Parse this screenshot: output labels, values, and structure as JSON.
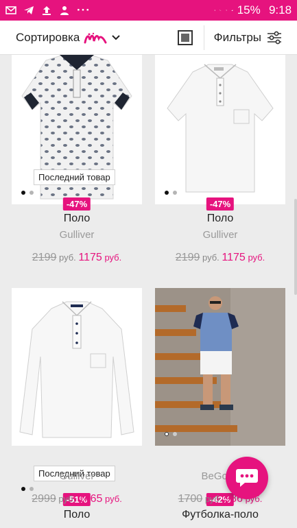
{
  "status_bar": {
    "battery": "15%",
    "time": "9:18",
    "more": "···",
    "icons": [
      "envelope-icon",
      "telegram-icon",
      "upload-icon",
      "person-icon",
      "bluetooth-icon",
      "call-icon",
      "wifi-icon",
      "signal-icon",
      "battery-icon"
    ]
  },
  "toolbar": {
    "sort_label": "Сортировка",
    "filters_label": "Фильтры"
  },
  "colors": {
    "accent": "#e6137e"
  },
  "products": [
    {
      "badge": "Последний товар",
      "discount": "-47%",
      "name": "Поло",
      "brand": "Gulliver",
      "old_price": "2199",
      "old_currency": "руб.",
      "new_price": "1175",
      "new_currency": "руб.",
      "image_count": 2,
      "active_image": 1
    },
    {
      "badge": "",
      "discount": "-47%",
      "name": "Поло",
      "brand": "Gulliver",
      "old_price": "2199",
      "old_currency": "руб.",
      "new_price": "1175",
      "new_currency": "руб.",
      "image_count": 2,
      "active_image": 1
    },
    {
      "badge": "Последний товар",
      "discount": "-51%",
      "name": "Поло",
      "brand": "Gulliver",
      "old_price": "2999",
      "old_currency": "руб.",
      "new_price": "1465",
      "new_currency": "руб.",
      "image_count": 2,
      "active_image": 1
    },
    {
      "badge": "",
      "discount": "-42%",
      "name": "Футболка-поло",
      "brand": "BeGood",
      "old_price": "1700",
      "old_currency": "руб.",
      "new_price": "986",
      "new_currency": "руб.",
      "image_count": 2,
      "active_image": 1
    }
  ]
}
